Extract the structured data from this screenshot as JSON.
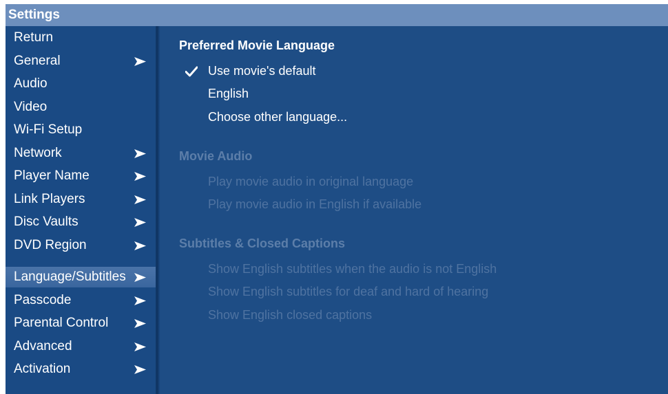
{
  "window": {
    "title": "Settings"
  },
  "sidebar": {
    "items": [
      {
        "label": "Return",
        "has_arrow": false
      },
      {
        "label": "General",
        "has_arrow": true
      },
      {
        "label": "Audio",
        "has_arrow": false
      },
      {
        "label": "Video",
        "has_arrow": false
      },
      {
        "label": "Wi-Fi Setup",
        "has_arrow": false
      },
      {
        "label": "Network",
        "has_arrow": true
      },
      {
        "label": "Player Name",
        "has_arrow": true
      },
      {
        "label": "Link Players",
        "has_arrow": true
      },
      {
        "label": "Disc Vaults",
        "has_arrow": true
      },
      {
        "label": "DVD Region",
        "has_arrow": true
      },
      {
        "label": "Language/Subtitles",
        "has_arrow": true,
        "selected": true
      },
      {
        "label": "Passcode",
        "has_arrow": true
      },
      {
        "label": "Parental Control",
        "has_arrow": true
      },
      {
        "label": "Advanced",
        "has_arrow": true
      },
      {
        "label": "Activation",
        "has_arrow": true
      }
    ],
    "arrow_icon": "chevron-right-icon"
  },
  "content": {
    "preferred_language": {
      "title": "Preferred Movie Language",
      "options": [
        {
          "label": "Use movie's default",
          "checked": true
        },
        {
          "label": "English",
          "checked": false
        },
        {
          "label": "Choose other language...",
          "checked": false
        }
      ]
    },
    "movie_audio": {
      "title": "Movie Audio",
      "enabled": false,
      "options": [
        {
          "label": "Play movie audio in original language"
        },
        {
          "label": "Play movie audio in English if available"
        }
      ]
    },
    "subtitles": {
      "title": "Subtitles & Closed Captions",
      "enabled": false,
      "options": [
        {
          "label": "Show English subtitles when the audio is not English"
        },
        {
          "label": "Show English subtitles for deaf and hard of hearing"
        },
        {
          "label": "Show English closed captions"
        }
      ]
    }
  },
  "colors": {
    "background": "#1e4d85",
    "title_bar": "#6d8fbd",
    "selected_item": "#4a73a8",
    "text": "#ffffff",
    "disabled_text": "#4f73a1"
  }
}
